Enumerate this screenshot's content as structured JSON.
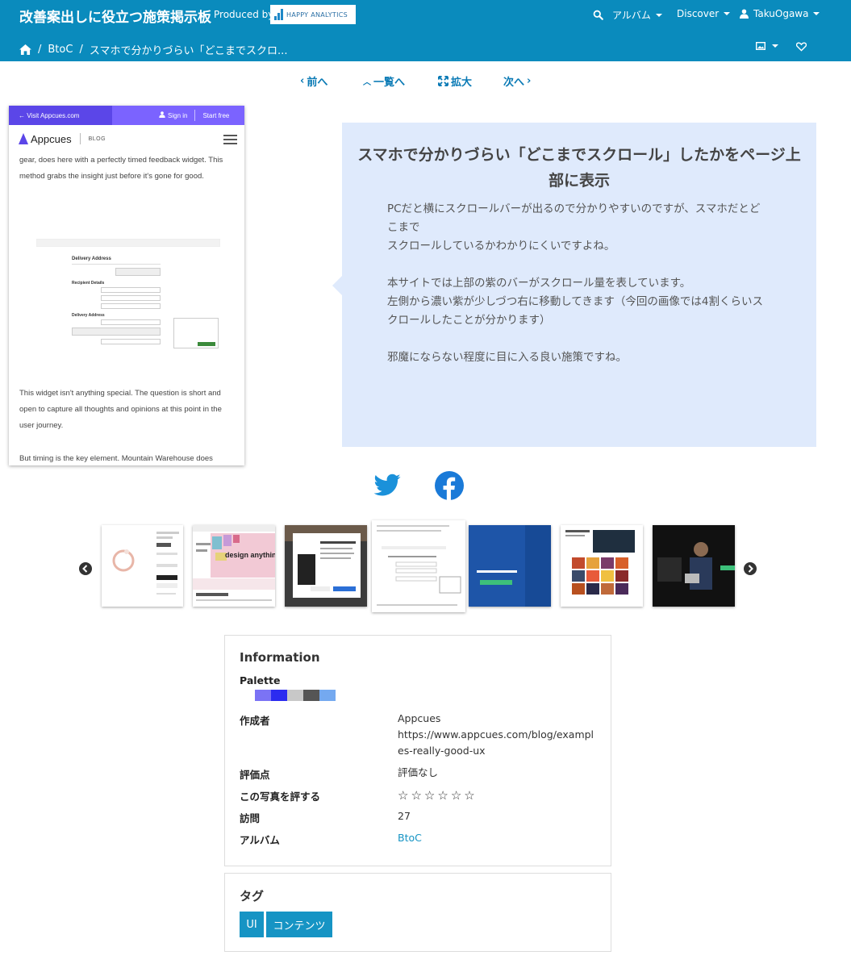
{
  "header": {
    "site_title": "改善案出しに役立つ施策掲示板",
    "produced_by": "Produced by",
    "partner_logo": "HAPPY ANALYTICS",
    "nav": [
      {
        "label": "アルバム",
        "icon": "search-icon"
      },
      {
        "label": "Discover"
      },
      {
        "label": "TakuOgawa",
        "icon": "user-icon"
      }
    ]
  },
  "breadcrumb": {
    "home_icon": "home-icon",
    "items": [
      "BtoC",
      "スマホで分かりづらい「どこまでスクロ..."
    ]
  },
  "pager": {
    "prev": "前へ",
    "list": "一覧へ",
    "zoom": "拡大",
    "next": "次へ"
  },
  "screenshot": {
    "visit_link": "← Visit Appcues.com",
    "signin": "Sign in",
    "start_free": "Start free",
    "brand": "Appcues",
    "blog": "BLOG",
    "para1": "gear, does here with a perfectly timed feedback widget. This method grabs the insight just before it's gone for good.",
    "form_title": "Delivery Address",
    "form_sub1": "Recipient Details",
    "form_sub2": "Delivery Address",
    "para2": "This widget isn't anything special. The question is short and open to capture all thoughts and opinions at this point in the user journey.",
    "para3": "But timing is the key element. Mountain Warehouse does"
  },
  "description": {
    "title": "スマホで分かりづらい「どこまでスクロール」したかをページ上部に表示",
    "body": "PCだと横にスクロールバーが出るので分かりやすいのですが、スマホだとどこまで\nスクロールしているかわかりにくいですよね。\n\n本サイトでは上部の紫のバーがスクロール量を表しています。\n左側から濃い紫が少しづつ右に移動してきます（今回の画像では4割くらいスクロールしたことが分かります）\n\n邪魔にならない程度に目に入る良い施策ですね。"
  },
  "social": {
    "twitter": "twitter-icon",
    "facebook": "facebook-icon"
  },
  "thumbnails": {
    "items": [
      {
        "name": "thumb-ring"
      },
      {
        "name": "thumb-design-anything",
        "text": "design anything."
      },
      {
        "name": "thumb-ebook"
      },
      {
        "name": "thumb-appcues",
        "active": true
      },
      {
        "name": "thumb-blue"
      },
      {
        "name": "thumb-essential"
      },
      {
        "name": "thumb-video"
      }
    ]
  },
  "info": {
    "heading": "Information",
    "palette_label": "Palette",
    "palette": [
      "#7b73f5",
      "#2b2bf0",
      "#c8c8c8",
      "#555555",
      "#74a9f0"
    ],
    "author_label": "作成者",
    "author_name": "Appcues",
    "author_url": "https://www.appcues.com/blog/examples-really-good-ux",
    "rating_label": "評価点",
    "rating_value": "評価なし",
    "rate_label": "この写真を評する",
    "stars": [
      "☆",
      "☆",
      "☆",
      "☆",
      "☆",
      "☆"
    ],
    "visits_label": "訪問",
    "visits_value": "27",
    "album_label": "アルバム",
    "album_value": "BtoC"
  },
  "tags": {
    "heading": "タグ",
    "items": [
      "UI",
      "コンテンツ"
    ]
  },
  "colors": {
    "header_bg": "#0a8bbd",
    "accent": "#1694c4",
    "desc_bg": "#dfeafc"
  }
}
